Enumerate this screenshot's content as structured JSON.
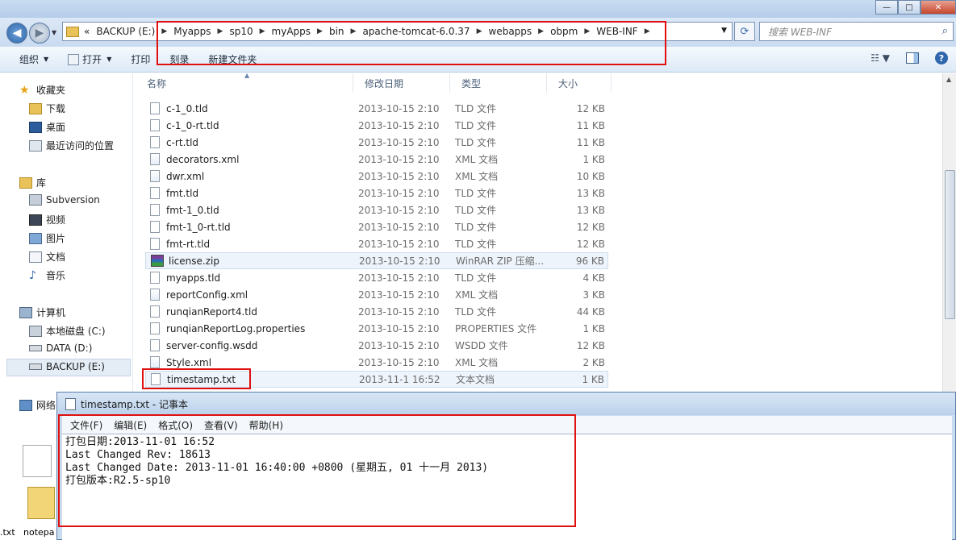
{
  "address": {
    "root": "BACKUP (E:)",
    "crumbs": [
      "Myapps",
      "sp10",
      "myApps",
      "bin",
      "apache-tomcat-6.0.37",
      "webapps",
      "obpm",
      "WEB-INF"
    ],
    "search_placeholder": "搜索 WEB-INF"
  },
  "toolbar": {
    "organize": "组织",
    "open": "打开",
    "print": "打印",
    "burn": "刻录",
    "new_folder": "新建文件夹"
  },
  "nav": {
    "favorites": "收藏夹",
    "downloads": "下载",
    "desktop": "桌面",
    "recent": "最近访问的位置",
    "libraries": "库",
    "subversion": "Subversion",
    "videos": "视频",
    "pictures": "图片",
    "documents": "文档",
    "music": "音乐",
    "computer": "计算机",
    "local_c": "本地磁盘 (C:)",
    "data_d": "DATA (D:)",
    "backup_e": "BACKUP (E:)",
    "network": "网络"
  },
  "columns": {
    "name": "名称",
    "date": "修改日期",
    "type": "类型",
    "size": "大小"
  },
  "files": [
    {
      "name": "c-1_0.tld",
      "date": "2013-10-15 2:10",
      "type": "TLD 文件",
      "size": "12 KB"
    },
    {
      "name": "c-1_0-rt.tld",
      "date": "2013-10-15 2:10",
      "type": "TLD 文件",
      "size": "11 KB"
    },
    {
      "name": "c-rt.tld",
      "date": "2013-10-15 2:10",
      "type": "TLD 文件",
      "size": "11 KB"
    },
    {
      "name": "decorators.xml",
      "date": "2013-10-15 2:10",
      "type": "XML 文档",
      "size": "1 KB"
    },
    {
      "name": "dwr.xml",
      "date": "2013-10-15 2:10",
      "type": "XML 文档",
      "size": "10 KB"
    },
    {
      "name": "fmt.tld",
      "date": "2013-10-15 2:10",
      "type": "TLD 文件",
      "size": "13 KB"
    },
    {
      "name": "fmt-1_0.tld",
      "date": "2013-10-15 2:10",
      "type": "TLD 文件",
      "size": "13 KB"
    },
    {
      "name": "fmt-1_0-rt.tld",
      "date": "2013-10-15 2:10",
      "type": "TLD 文件",
      "size": "12 KB"
    },
    {
      "name": "fmt-rt.tld",
      "date": "2013-10-15 2:10",
      "type": "TLD 文件",
      "size": "12 KB"
    },
    {
      "name": "license.zip",
      "date": "2013-10-15 2:10",
      "type": "WinRAR ZIP 压缩...",
      "size": "96 KB"
    },
    {
      "name": "myapps.tld",
      "date": "2013-10-15 2:10",
      "type": "TLD 文件",
      "size": "4 KB"
    },
    {
      "name": "reportConfig.xml",
      "date": "2013-10-15 2:10",
      "type": "XML 文档",
      "size": "3 KB"
    },
    {
      "name": "runqianReport4.tld",
      "date": "2013-10-15 2:10",
      "type": "TLD 文件",
      "size": "44 KB"
    },
    {
      "name": "runqianReportLog.properties",
      "date": "2013-10-15 2:10",
      "type": "PROPERTIES 文件",
      "size": "1 KB"
    },
    {
      "name": "server-config.wsdd",
      "date": "2013-10-15 2:10",
      "type": "WSDD 文件",
      "size": "12 KB"
    },
    {
      "name": "Style.xml",
      "date": "2013-10-15 2:10",
      "type": "XML 文档",
      "size": "2 KB"
    },
    {
      "name": "timestamp.txt",
      "date": "2013-11-1 16:52",
      "type": "文本文档",
      "size": "1 KB"
    }
  ],
  "notepad": {
    "title": "timestamp.txt - 记事本",
    "menu": [
      "文件(F)",
      "编辑(E)",
      "格式(O)",
      "查看(V)",
      "帮助(H)"
    ],
    "lines": [
      "打包日期:2013-11-01 16:52",
      "Last Changed Rev: 18613",
      "Last Changed Date: 2013-11-01 16:40:00 +0800 (星期五, 01 十一月 2013)",
      "打包版本:R2.5-sp10"
    ]
  },
  "desktop": {
    "label1": ".txt",
    "label2": "notepa"
  },
  "colors": {
    "annotation": "#e01010",
    "selection": "#eef4fc"
  }
}
